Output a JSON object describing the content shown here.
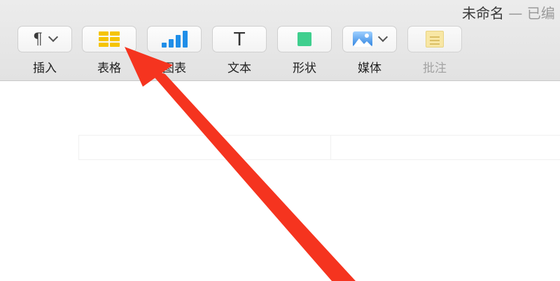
{
  "window": {
    "title": "未命名",
    "subtitle": "— 已编"
  },
  "toolbar": {
    "items": [
      {
        "name": "insert",
        "label": "插入",
        "icon": "paragraph-icon",
        "has_dropdown": true,
        "enabled": true
      },
      {
        "name": "table",
        "label": "表格",
        "icon": "table-icon",
        "has_dropdown": false,
        "enabled": true
      },
      {
        "name": "chart",
        "label": "图表",
        "icon": "chart-icon",
        "has_dropdown": false,
        "enabled": true
      },
      {
        "name": "text",
        "label": "文本",
        "icon": "text-icon",
        "has_dropdown": false,
        "enabled": true
      },
      {
        "name": "shape",
        "label": "形状",
        "icon": "shape-icon",
        "has_dropdown": false,
        "enabled": true
      },
      {
        "name": "media",
        "label": "媒体",
        "icon": "image-icon",
        "has_dropdown": true,
        "enabled": true
      },
      {
        "name": "comment",
        "label": "批注",
        "icon": "comment-icon",
        "has_dropdown": false,
        "enabled": false
      }
    ],
    "text_glyph": "T",
    "pilcrow_glyph": "¶"
  },
  "annotation": {
    "type": "red-arrow",
    "target": "table",
    "color": "#f5341f"
  },
  "colors": {
    "table_icon": "#f5c400",
    "chart_icon": "#1f8ee8",
    "shape_icon": "#3fcf8e",
    "note_icon": "#fbe79a",
    "arrow": "#f5341f"
  }
}
